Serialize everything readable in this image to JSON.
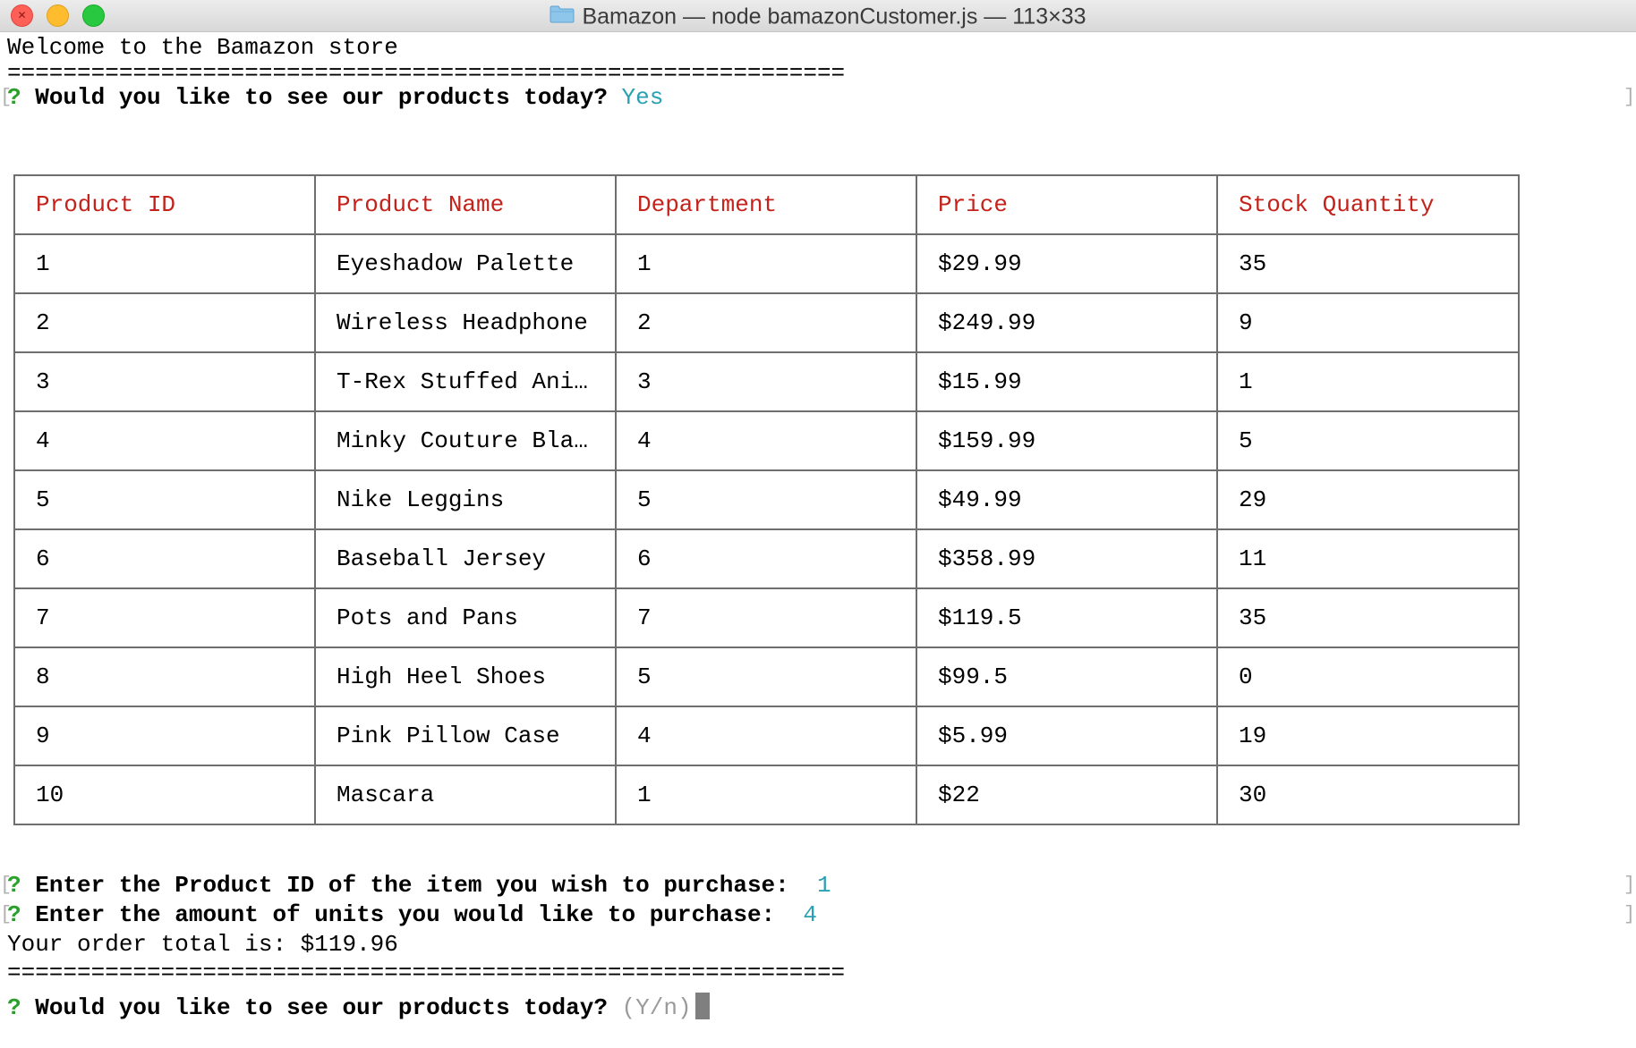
{
  "window": {
    "title": "Bamazon — node bamazonCustomer.js — 113×33",
    "folder_icon": "folder-icon",
    "controls": [
      "close",
      "minimize",
      "zoom"
    ]
  },
  "terminal": {
    "welcome": "Welcome to the Bamazon store",
    "separator": "============================================================",
    "prompt_mark": "?",
    "prompt_bracket": "[",
    "right_bracket": "]",
    "first_prompt": {
      "question": "Would you like to see our products today?",
      "answer": "Yes"
    },
    "table": {
      "headers": [
        "Product ID",
        "Product Name",
        "Department",
        "Price",
        "Stock Quantity"
      ],
      "rows": [
        [
          "1",
          "Eyeshadow Palette",
          "1",
          "$29.99",
          "35"
        ],
        [
          "2",
          "Wireless Headphone",
          "2",
          "$249.99",
          "9"
        ],
        [
          "3",
          "T-Rex Stuffed Ani…",
          "3",
          "$15.99",
          "1"
        ],
        [
          "4",
          "Minky Couture Bla…",
          "4",
          "$159.99",
          "5"
        ],
        [
          "5",
          "Nike Leggins",
          "5",
          "$49.99",
          "29"
        ],
        [
          "6",
          "Baseball Jersey",
          "6",
          "$358.99",
          "11"
        ],
        [
          "7",
          "Pots and Pans",
          "7",
          "$119.5",
          "35"
        ],
        [
          "8",
          "High Heel Shoes",
          "5",
          "$99.5",
          "0"
        ],
        [
          "9",
          "Pink Pillow Case",
          "4",
          "$5.99",
          "19"
        ],
        [
          "10",
          "Mascara",
          "1",
          "$22",
          "30"
        ]
      ]
    },
    "product_id_prompt": {
      "question": "Enter the Product ID of the item you wish to purchase:",
      "answer": "1"
    },
    "units_prompt": {
      "question": "Enter the amount of units you would like to purchase:",
      "answer": "4"
    },
    "order_total": "Your order total is: $119.96",
    "second_separator": "============================================================",
    "final_prompt": {
      "question": "Would you like to see our products today?",
      "hint": "(Y/n)"
    }
  },
  "colors": {
    "prompt_mark": "#2aa12a",
    "answer": "#2aa1b3",
    "table_header": "#c4221a",
    "hint": "#9a9a9a"
  }
}
